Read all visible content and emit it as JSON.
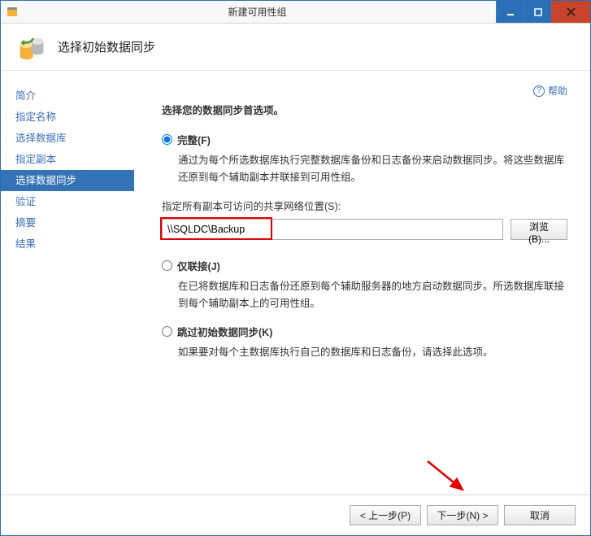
{
  "window": {
    "title": "新建可用性组"
  },
  "header": {
    "title": "选择初始数据同步"
  },
  "sidebar": {
    "items": [
      {
        "label": "简介"
      },
      {
        "label": "指定名称"
      },
      {
        "label": "选择数据库"
      },
      {
        "label": "指定副本"
      },
      {
        "label": "选择数据同步"
      },
      {
        "label": "验证"
      },
      {
        "label": "摘要"
      },
      {
        "label": "结果"
      }
    ],
    "selected_index": 4
  },
  "help": {
    "label": "帮助"
  },
  "content": {
    "lead": "选择您的数据同步首选项。",
    "opt_full": {
      "label": "完整(F)",
      "desc": "通过为每个所选数据库执行完整数据库备份和日志备份来启动数据同步。将这些数据库还原到每个辅助副本并联接到可用性组。",
      "share_label": "指定所有副本可访问的共享网络位置(S):",
      "share_value": "\\\\SQLDC\\Backup",
      "browse": "浏览(B)..."
    },
    "opt_join": {
      "label": "仅联接(J)",
      "desc": "在已将数据库和日志备份还原到每个辅助服务器的地方启动数据同步。所选数据库联接到每个辅助副本上的可用性组。"
    },
    "opt_skip": {
      "label": "跳过初始数据同步(K)",
      "desc": "如果要对每个主数据库执行自己的数据库和日志备份，请选择此选项。"
    }
  },
  "footer": {
    "prev": "< 上一步(P)",
    "next": "下一步(N) >",
    "cancel": "取消"
  }
}
